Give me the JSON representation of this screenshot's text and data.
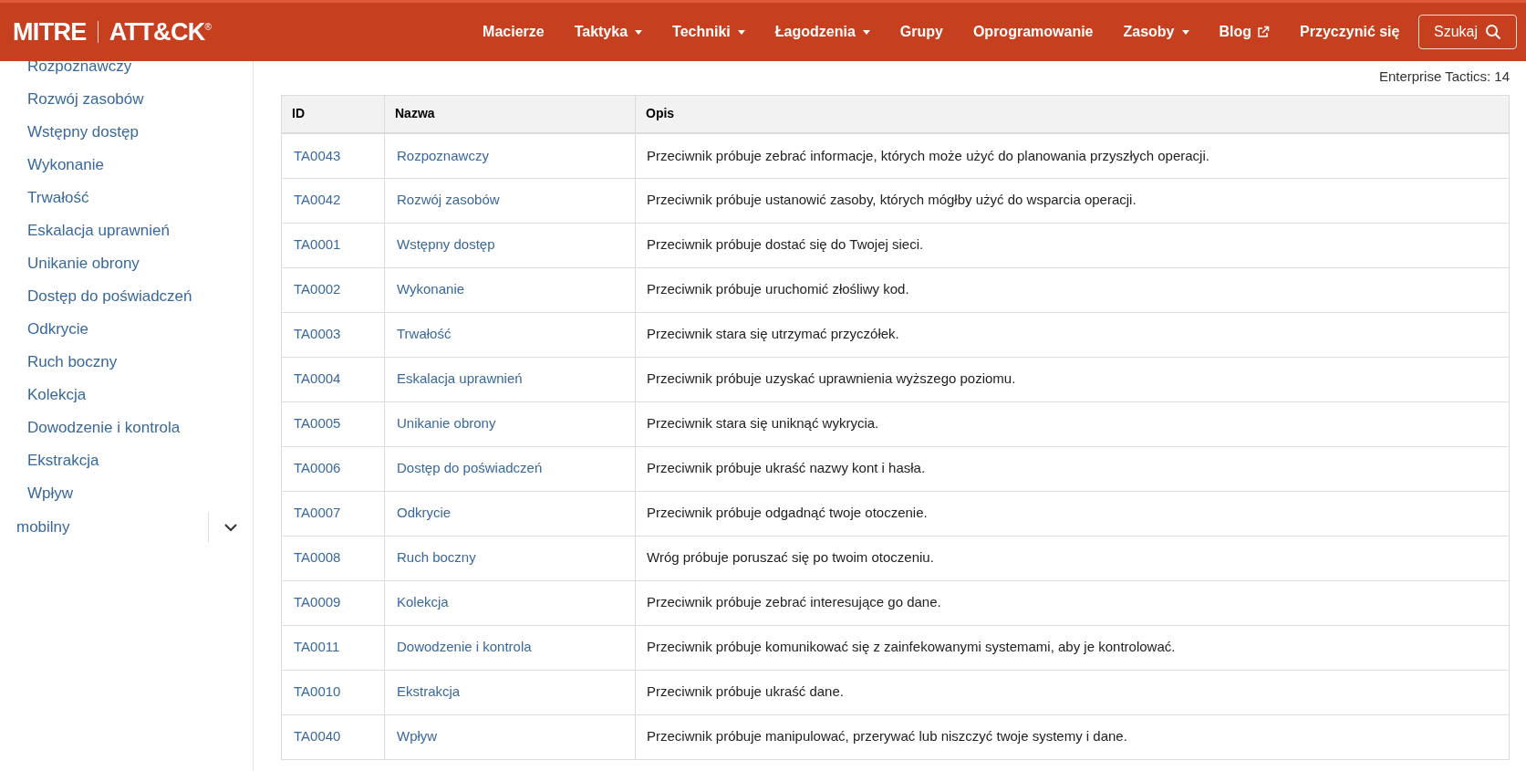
{
  "header": {
    "logo": {
      "left": "MITRE",
      "right": "ATT&CK",
      "mark": "®"
    },
    "nav": [
      {
        "label": "Macierze",
        "kind": "plain"
      },
      {
        "label": "Taktyka",
        "kind": "dropdown"
      },
      {
        "label": "Techniki",
        "kind": "dropdown"
      },
      {
        "label": "Łagodzenia",
        "kind": "dropdown"
      },
      {
        "label": "Grupy",
        "kind": "plain"
      },
      {
        "label": "Oprogramowanie",
        "kind": "plain"
      },
      {
        "label": "Zasoby",
        "kind": "dropdown"
      },
      {
        "label": "Blog",
        "kind": "external"
      },
      {
        "label": "Przyczynić się",
        "kind": "plain"
      }
    ],
    "search_button": "Szukaj"
  },
  "sidebar": {
    "items": [
      "Rozpoznawczy",
      "Rozwój zasobów",
      "Wstępny dostęp",
      "Wykonanie",
      "Trwałość",
      "Eskalacja uprawnień",
      "Unikanie obrony",
      "Dostęp do poświadczeń",
      "Odkrycie",
      "Ruch boczny",
      "Kolekcja",
      "Dowodzenie i kontrola",
      "Ekstrakcja",
      "Wpływ"
    ],
    "section": {
      "label": "mobilny",
      "expanded": false
    }
  },
  "count": "Enterprise Tactics: 14",
  "table": {
    "columns": [
      "ID",
      "Nazwa",
      "Opis"
    ],
    "rows": [
      [
        "TA0043",
        "Rozpoznawczy",
        "Przeciwnik próbuje zebrać informacje, których może użyć do planowania przyszłych operacji."
      ],
      [
        "TA0042",
        "Rozwój zasobów",
        "Przeciwnik próbuje ustanowić zasoby, których mógłby użyć do wsparcia operacji."
      ],
      [
        "TA0001",
        "Wstępny dostęp",
        "Przeciwnik próbuje dostać się do Twojej sieci."
      ],
      [
        "TA0002",
        "Wykonanie",
        "Przeciwnik próbuje uruchomić złośliwy kod."
      ],
      [
        "TA0003",
        "Trwałość",
        "Przeciwnik stara się utrzymać przyczółek."
      ],
      [
        "TA0004",
        "Eskalacja uprawnień",
        "Przeciwnik próbuje uzyskać uprawnienia wyższego poziomu."
      ],
      [
        "TA0005",
        "Unikanie obrony",
        "Przeciwnik stara się uniknąć wykrycia."
      ],
      [
        "TA0006",
        "Dostęp do poświadczeń",
        "Przeciwnik próbuje ukraść nazwy kont i hasła."
      ],
      [
        "TA0007",
        "Odkrycie",
        "Przeciwnik próbuje odgadnąć twoje otoczenie."
      ],
      [
        "TA0008",
        "Ruch boczny",
        "Wróg próbuje poruszać się po twoim otoczeniu."
      ],
      [
        "TA0009",
        "Kolekcja",
        "Przeciwnik próbuje zebrać interesujące go dane."
      ],
      [
        "TA0011",
        "Dowodzenie i kontrola",
        "Przeciwnik próbuje komunikować się z zainfekowanymi systemami, aby je kontrolować."
      ],
      [
        "TA0010",
        "Ekstrakcja",
        "Przeciwnik próbuje ukraść dane."
      ],
      [
        "TA0040",
        "Wpływ",
        "Przeciwnik próbuje manipulować, przerywać lub niszczyć twoje systemy i dane."
      ]
    ]
  }
}
